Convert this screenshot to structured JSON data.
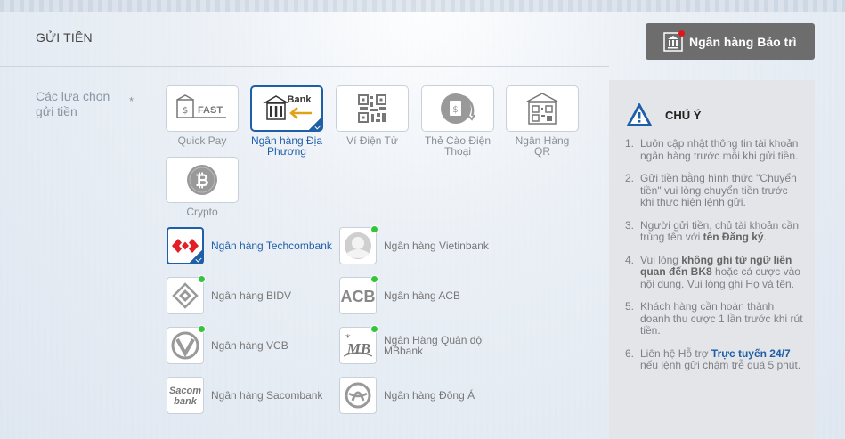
{
  "header": {
    "title": "GỬI TIỀN"
  },
  "maintenance_button": {
    "label": "Ngân hàng Bảo trì"
  },
  "options_label": "Các lựa chọn gửi tiền",
  "required_mark": "*",
  "methods": [
    {
      "label": "Quick Pay",
      "active": false,
      "logo_text": "FAST"
    },
    {
      "label": "Ngân hàng Địa Phương",
      "active": true,
      "logo_text": "Bank"
    },
    {
      "label": "Ví Điện Tử",
      "active": false
    },
    {
      "label": "Thẻ Cào Điện Thoại",
      "active": false
    },
    {
      "label": "Ngân Hàng QR",
      "active": false
    },
    {
      "label": "Crypto",
      "active": false
    }
  ],
  "banks": [
    {
      "name": "Ngân hàng Techcombank",
      "active": true
    },
    {
      "name": "Ngân hàng Vietinbank",
      "active": false
    },
    {
      "name": "Ngân hàng BIDV",
      "active": false
    },
    {
      "name": "Ngân hàng ACB",
      "active": false,
      "logo_text": "ACB"
    },
    {
      "name": "Ngân hàng VCB",
      "active": false
    },
    {
      "name": "Ngân Hàng Quân đội MBbank",
      "active": false,
      "logo_text": "MB"
    },
    {
      "name": "Ngân hàng Sacombank",
      "active": false,
      "logo_text_1": "Sacom",
      "logo_text_2": "bank"
    },
    {
      "name": "Ngân hàng Đông Á",
      "active": false
    }
  ],
  "notice": {
    "title": "CHÚ Ý",
    "items": [
      {
        "n": "1.",
        "text": "Luôn cập nhật thông tin tài khoản ngân hàng trước mỗi khi gửi tiền."
      },
      {
        "n": "2.",
        "text": "Gửi tiền bằng hình thức \"Chuyển tiền\" vui lòng chuyển tiền trước khi thực hiện lệnh gửi."
      },
      {
        "n": "3.",
        "pre": "Người gửi tiền, chủ tài khoản cần trùng tên với ",
        "bold": "tên Đăng ký",
        "post": "."
      },
      {
        "n": "4.",
        "pre": "Vui lòng ",
        "bold": "không ghi từ ngữ liên quan đến BK8",
        "post": " hoặc cá cược vào nội dung. Vui lòng ghi Họ và tên."
      },
      {
        "n": "5.",
        "text": "Khách hàng cần hoàn thành doanh thu cược 1 lần trước khi rút tiền."
      },
      {
        "n": "6.",
        "pre": "Liên hệ Hỗ trợ ",
        "link": "Trực tuyến 24/7",
        "post": " nếu lệnh gửi chậm trễ quá 5 phút."
      }
    ]
  },
  "colors": {
    "accent": "#1f5fa8",
    "online": "#35c43a",
    "maintenance_bg": "#6d6d6d"
  }
}
